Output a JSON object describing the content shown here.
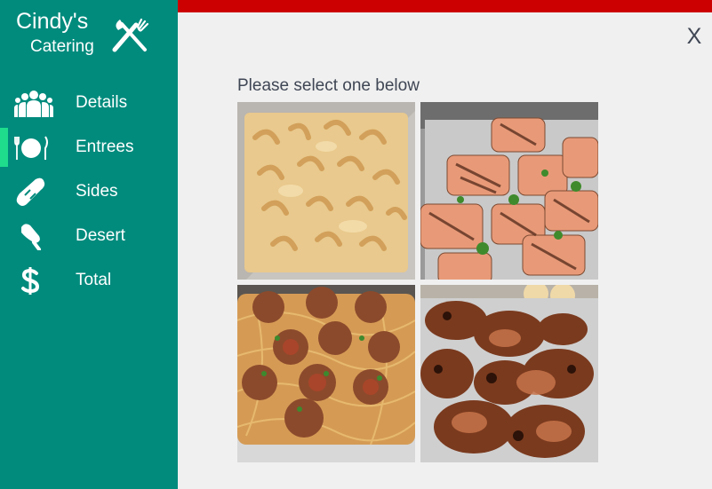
{
  "brand": {
    "name": "Cindy's",
    "subtitle": "Catering",
    "logo_icon": "fork-knife-icon"
  },
  "nav": {
    "items": [
      {
        "label": "Details",
        "icon": "people-icon"
      },
      {
        "label": "Entrees",
        "icon": "plate-utensils-icon",
        "active": true
      },
      {
        "label": "Sides",
        "icon": "bread-icon"
      },
      {
        "label": "Desert",
        "icon": "popsicle-icon"
      },
      {
        "label": "Total",
        "icon": "dollar-icon"
      }
    ]
  },
  "colors": {
    "sidebar": "#008b7d",
    "top_bar": "#cc0000",
    "active_indicator": "#1edc8c",
    "background": "#f0f0f0",
    "text": "#3f4654"
  },
  "close": {
    "label": "X"
  },
  "main": {
    "prompt": "Please select one below",
    "options": [
      {
        "icon": "mac-and-cheese-image"
      },
      {
        "icon": "grilled-salmon-image"
      },
      {
        "icon": "spaghetti-meatballs-image"
      },
      {
        "icon": "grilled-chicken-image"
      }
    ]
  }
}
